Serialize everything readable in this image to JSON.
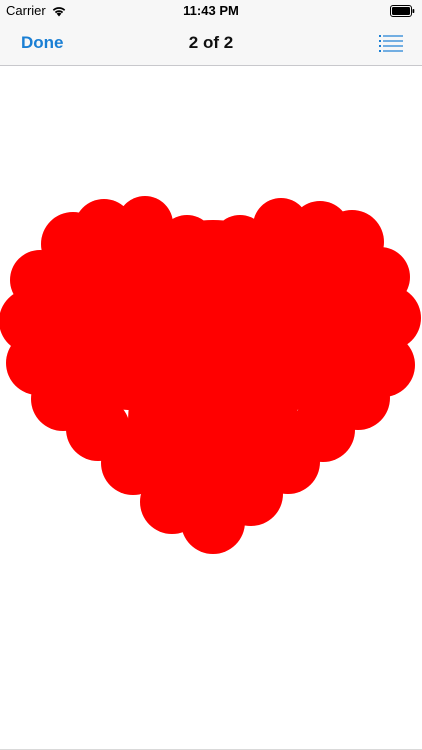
{
  "status_bar": {
    "carrier": "Carrier",
    "time": "11:43 PM",
    "wifi_icon": "wifi-icon",
    "battery_icon": "battery-icon"
  },
  "nav": {
    "done_label": "Done",
    "title": "2 of 2",
    "list_icon": "list-icon",
    "accent_color": "#1a7fd4"
  },
  "content": {
    "shape": "heart",
    "shape_color": "#ff0000"
  }
}
